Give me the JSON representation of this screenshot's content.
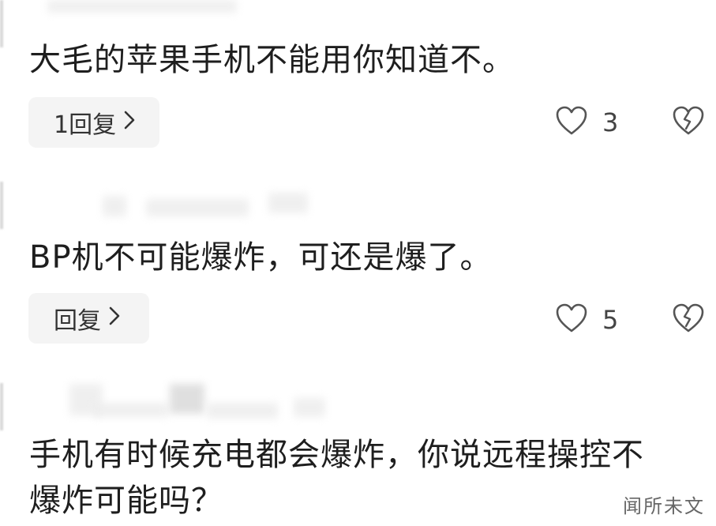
{
  "comments": [
    {
      "text": "大毛的苹果手机不能用你知道不。",
      "reply_label": "1回复",
      "like_count": "3"
    },
    {
      "text": "BP机不可能爆炸，可还是爆了。",
      "reply_label": "回复",
      "like_count": "5"
    },
    {
      "text_line1": "手机有时候充电都会爆炸，你说远程操控不",
      "text_line2": "爆炸可能吗？"
    }
  ],
  "icons": {
    "like": "heart-outline-icon",
    "dislike": "broken-heart-icon",
    "chevron": "chevron-right-icon"
  },
  "watermark": "闻所未文",
  "colors": {
    "text": "#1e1e1e",
    "reply_bg": "#f4f4f4",
    "icon": "#555555"
  }
}
